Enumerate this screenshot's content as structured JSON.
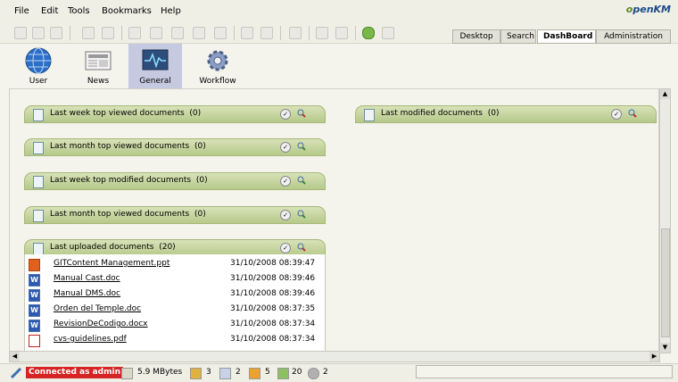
{
  "menu": [
    "File",
    "Edit",
    "Tools",
    "Bookmarks",
    "Help"
  ],
  "logo": "penKM",
  "tabs": [
    "Desktop",
    "Search",
    "DashBoard",
    "Administration"
  ],
  "active_tab": "DashBoard",
  "workspaces": [
    {
      "label": "User",
      "icon": "globe-icon"
    },
    {
      "label": "News",
      "icon": "newspaper-icon"
    },
    {
      "label": "General",
      "icon": "monitor-icon"
    },
    {
      "label": "Workflow",
      "icon": "gear-icon"
    }
  ],
  "active_workspace": "General",
  "widgets_left": [
    {
      "title": "Last week top viewed documents",
      "count": "(0)"
    },
    {
      "title": "Last month top viewed documents",
      "count": "(0)"
    },
    {
      "title": "Last week top modified documents",
      "count": "(0)"
    },
    {
      "title": "Last month top viewed documents",
      "count": "(0)"
    },
    {
      "title": "Last uploaded documents",
      "count": "(20)"
    }
  ],
  "widgets_right": [
    {
      "title": "Last modified documents",
      "count": "(0)"
    }
  ],
  "uploaded_docs": [
    {
      "type": "ppt",
      "icon_letter": "",
      "name": "GITContent Management.ppt",
      "date": "31/10/2008 08:39:47"
    },
    {
      "type": "doc",
      "icon_letter": "W",
      "name": "Manual Cast.doc",
      "date": "31/10/2008 08:39:46"
    },
    {
      "type": "doc",
      "icon_letter": "W",
      "name": "Manual DMS.doc",
      "date": "31/10/2008 08:39:46"
    },
    {
      "type": "doc",
      "icon_letter": "W",
      "name": "Orden del Temple.doc",
      "date": "31/10/2008 08:37:35"
    },
    {
      "type": "doc",
      "icon_letter": "W",
      "name": "RevisionDeCodigo.docx",
      "date": "31/10/2008 08:37:34"
    },
    {
      "type": "pdf",
      "icon_letter": "",
      "name": "cvs-guidelines.pdf",
      "date": "31/10/2008 08:37:34"
    }
  ],
  "status": {
    "connected": "Connected as admin",
    "size": "5.9 MBytes",
    "locked": "3",
    "checkout": "2",
    "mail": "5",
    "subscribed": "20",
    "workflows": "2"
  }
}
